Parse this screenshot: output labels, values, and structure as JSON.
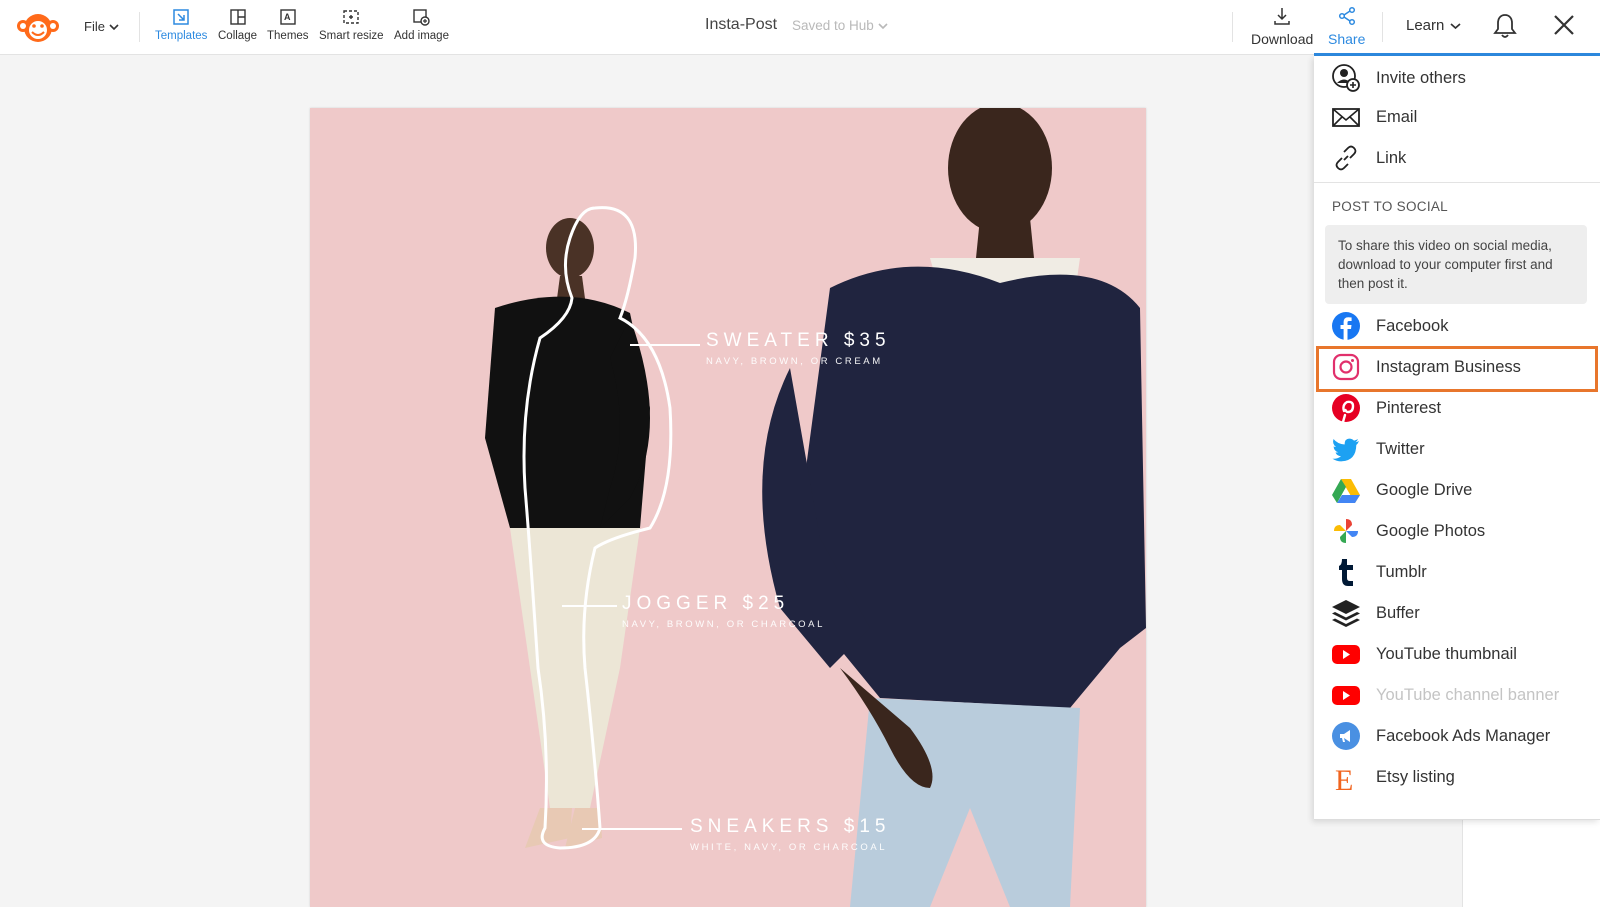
{
  "toolbar": {
    "file_label": "File",
    "tools": [
      {
        "label": "Templates",
        "icon": "templates-icon",
        "active": true
      },
      {
        "label": "Collage",
        "icon": "collage-icon",
        "active": false
      },
      {
        "label": "Themes",
        "icon": "themes-icon",
        "active": false
      },
      {
        "label": "Smart resize",
        "icon": "smart-resize-icon",
        "active": false
      },
      {
        "label": "Add image",
        "icon": "add-image-icon",
        "active": false
      }
    ],
    "document_title": "Insta-Post",
    "saved_status": "Saved to Hub",
    "download_label": "Download",
    "share_label": "Share",
    "learn_label": "Learn"
  },
  "canvas": {
    "captions": [
      {
        "title": "SWEATER $35",
        "subtitle": "NAVY, BROWN, OR CREAM"
      },
      {
        "title": "JOGGER $25",
        "subtitle": "NAVY, BROWN, OR CHARCOAL"
      },
      {
        "title": "SNEAKERS $15",
        "subtitle": "WHITE, NAVY, OR CHARCOAL"
      }
    ]
  },
  "share_menu": {
    "top_items": [
      {
        "label": "Invite others",
        "icon": "invite-user-icon"
      },
      {
        "label": "Email",
        "icon": "email-icon"
      },
      {
        "label": "Link",
        "icon": "link-icon"
      }
    ],
    "section_title": "POST TO SOCIAL",
    "note": "To share this video on social media, download to your computer first and then post it.",
    "social_items": [
      {
        "label": "Facebook",
        "icon": "facebook-icon",
        "disabled": false
      },
      {
        "label": "Instagram Business",
        "icon": "instagram-icon",
        "disabled": false,
        "highlighted": true
      },
      {
        "label": "Pinterest",
        "icon": "pinterest-icon",
        "disabled": false
      },
      {
        "label": "Twitter",
        "icon": "twitter-icon",
        "disabled": false
      },
      {
        "label": "Google Drive",
        "icon": "google-drive-icon",
        "disabled": false
      },
      {
        "label": "Google Photos",
        "icon": "google-photos-icon",
        "disabled": false
      },
      {
        "label": "Tumblr",
        "icon": "tumblr-icon",
        "disabled": false
      },
      {
        "label": "Buffer",
        "icon": "buffer-icon",
        "disabled": false
      },
      {
        "label": "YouTube thumbnail",
        "icon": "youtube-icon",
        "disabled": false
      },
      {
        "label": "YouTube channel banner",
        "icon": "youtube-icon",
        "disabled": true
      },
      {
        "label": "Facebook Ads Manager",
        "icon": "facebook-ads-icon",
        "disabled": false
      },
      {
        "label": "Etsy listing",
        "icon": "etsy-icon",
        "disabled": false
      }
    ]
  },
  "colors": {
    "accent": "#2d8ae0",
    "highlight": "#e8762c",
    "canvas_bg": "#efc9c9",
    "brand_orange": "#ff6a1a"
  }
}
